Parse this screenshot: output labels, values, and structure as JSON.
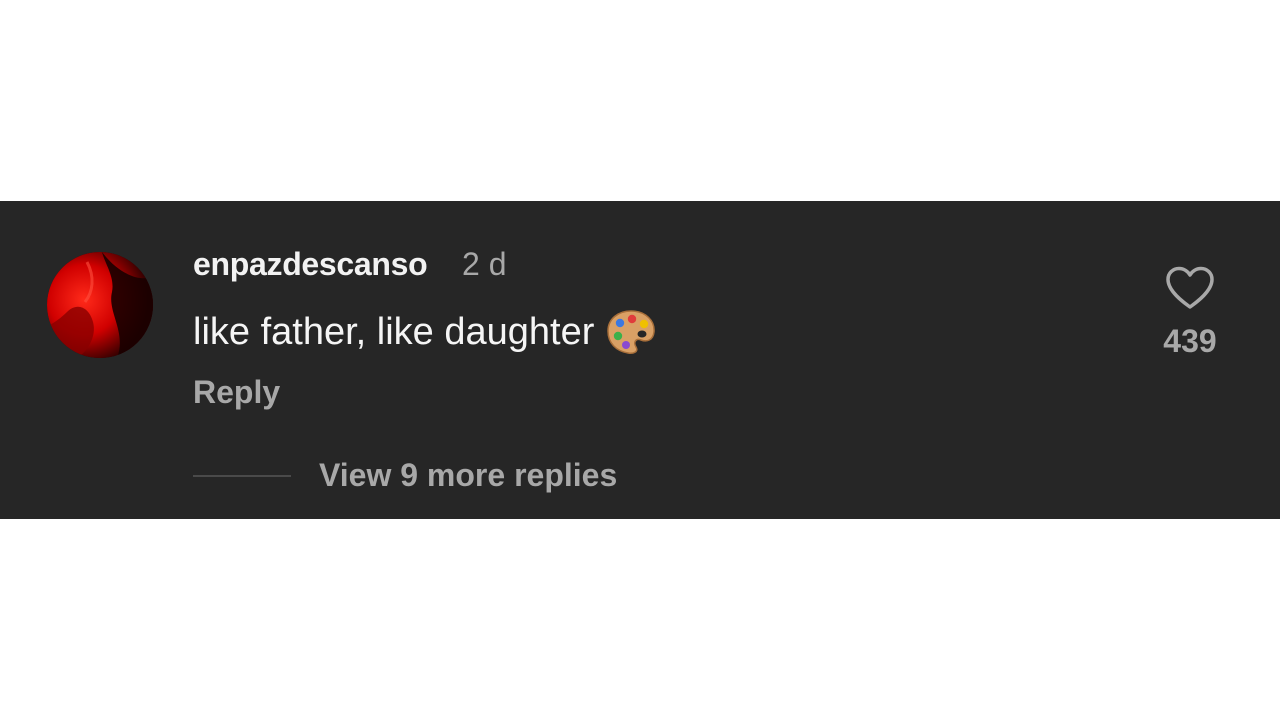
{
  "comment": {
    "username": "enpazdescanso",
    "timestamp": "2 d",
    "text": "like father, like daughter",
    "emoji": "palette-icon",
    "reply_label": "Reply",
    "like_count": "439",
    "view_replies_label": "View 9 more replies"
  },
  "colors": {
    "panel_background": "#262626",
    "primary_text": "#f5f5f5",
    "secondary_text": "#a8a8a8",
    "avatar_accent": "#e00000"
  }
}
